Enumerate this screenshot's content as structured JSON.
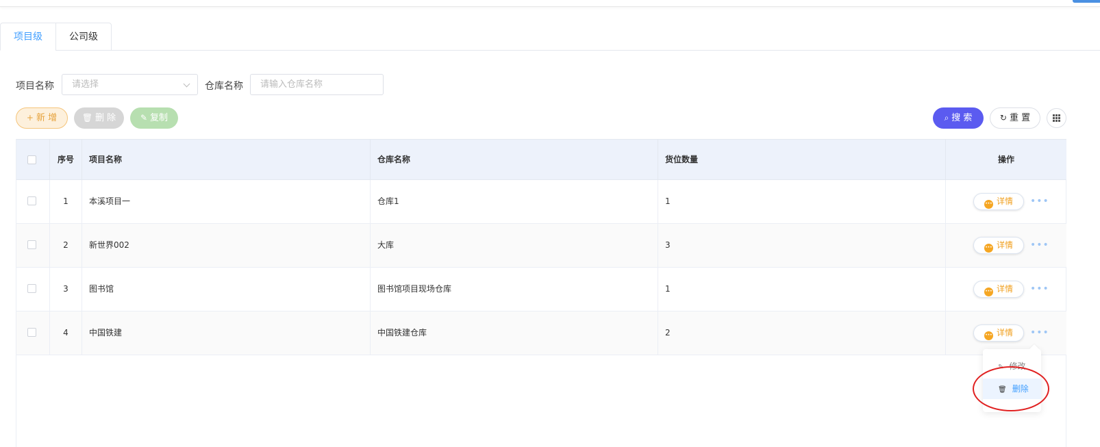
{
  "tabs": [
    {
      "label": "项目级",
      "active": true
    },
    {
      "label": "公司级",
      "active": false
    }
  ],
  "filters": {
    "project_label": "项目名称",
    "project_placeholder": "请选择",
    "warehouse_label": "仓库名称",
    "warehouse_placeholder": "请输入仓库名称"
  },
  "toolbar": {
    "add_label": "新 增",
    "delete_label": "删 除",
    "copy_label": "复制",
    "search_label": "搜 索",
    "reset_label": "重 置"
  },
  "table": {
    "headers": {
      "index": "序号",
      "project": "项目名称",
      "warehouse": "仓库名称",
      "slots": "货位数量",
      "ops": "操作"
    },
    "rows": [
      {
        "index": "1",
        "project": "本溪项目一",
        "warehouse": "仓库1",
        "slots": "1",
        "detail": "详情"
      },
      {
        "index": "2",
        "project": "新世界002",
        "warehouse": "大库",
        "slots": "3",
        "detail": "详情"
      },
      {
        "index": "3",
        "project": "图书馆",
        "warehouse": "图书馆项目现场仓库",
        "slots": "1",
        "detail": "详情"
      },
      {
        "index": "4",
        "project": "中国铁建",
        "warehouse": "中国铁建仓库",
        "slots": "2",
        "detail": "详情"
      }
    ]
  },
  "dropdown": {
    "edit_label": "修改",
    "delete_label": "删除"
  },
  "icons": {
    "add": "plus-icon",
    "delete": "trash-icon",
    "copy": "edit-icon",
    "search": "search-icon",
    "reset": "refresh-icon",
    "columns": "grid-icon",
    "detail": "more-circle-icon",
    "more": "ellipsis-icon"
  },
  "colors": {
    "primary": "#409eff",
    "search": "#5b5bf0",
    "detail": "#f0a020",
    "highlight": "#e02020"
  }
}
